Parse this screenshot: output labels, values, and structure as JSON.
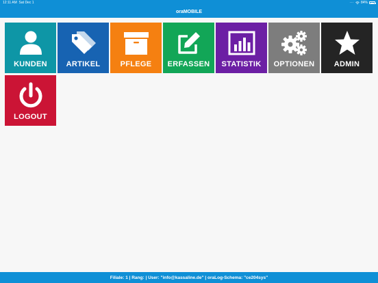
{
  "statusbar": {
    "time": "12:11 AM",
    "date": "Sat Dec 1",
    "battery": "84%"
  },
  "navbar": {
    "title": "oraMOBILE"
  },
  "tiles": [
    {
      "id": "kunden",
      "label": "KUNDEN",
      "icon": "user-icon",
      "color": "#0e96a6"
    },
    {
      "id": "artikel",
      "label": "ARTIKEL",
      "icon": "tags-icon",
      "color": "#1763b2"
    },
    {
      "id": "pflege",
      "label": "PFLEGE",
      "icon": "archive-box-icon",
      "color": "#f58011"
    },
    {
      "id": "erfassen",
      "label": "ERFASSEN",
      "icon": "edit-icon",
      "color": "#12a657"
    },
    {
      "id": "statistik",
      "label": "STATISTIK",
      "icon": "bar-chart-icon",
      "color": "#6c1fa4"
    },
    {
      "id": "optionen",
      "label": "OPTIONEN",
      "icon": "gears-icon",
      "color": "#7d7d7d"
    },
    {
      "id": "admin",
      "label": "ADMIN",
      "icon": "star-icon",
      "color": "#242424"
    },
    {
      "id": "logout",
      "label": "LOGOUT",
      "icon": "power-icon",
      "color": "#cb1435"
    }
  ],
  "footer": {
    "text": "Filiale: 1 | Rang: | User: \"info@kassaline.de\" | oraLog-Schema: \"ce204sys\""
  }
}
